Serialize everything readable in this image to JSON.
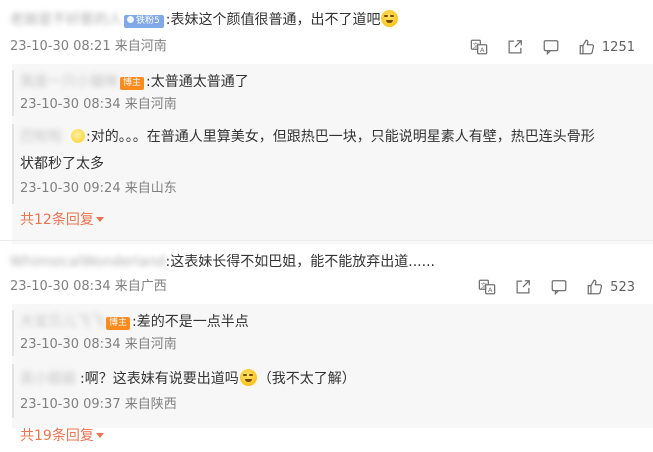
{
  "comments": [
    {
      "user": "老娘是不好惹的人",
      "fans_badge": "铁粉5",
      "text": ":表妹这个颜值很普通，出不了道吧",
      "meta": "23-10-30 08:21 来自河南",
      "likes": "1251",
      "replies": [
        {
          "user": "我是一只小猫咪",
          "badge": "博主",
          "text": ":太普通太普通了",
          "meta": "23-10-30 08:34 来自河南"
        },
        {
          "user": "巴啦啦",
          "text_line1": ":对的。。。在普通人里算美女，但跟热巴一块，只能说明星素人有壁，热巴连头骨形",
          "text_line2": "状都秒了太多",
          "meta": "23-10-30 09:24 来自山东"
        }
      ],
      "more": "共12条回复"
    },
    {
      "user": "WhimsicalWonderland",
      "text": ":这表妹长得不如巴姐，能不能放弃出道......",
      "meta": "23-10-30 08:34 来自广西",
      "likes": "523",
      "replies": [
        {
          "user": "大宝贝儿飞飞",
          "badge": "博主",
          "text": ":差的不是一点半点",
          "meta": "23-10-30 08:34 来自河南"
        },
        {
          "user": "吴小姐姐",
          "text_before": ":啊？这表妹有说要出道吗",
          "text_after": "（我不太了解）",
          "meta": "23-10-30 09:37 来自陕西"
        }
      ],
      "more": "共19条回复"
    }
  ],
  "icons": [
    "translate-icon",
    "share-icon",
    "comment-icon",
    "like-icon"
  ]
}
